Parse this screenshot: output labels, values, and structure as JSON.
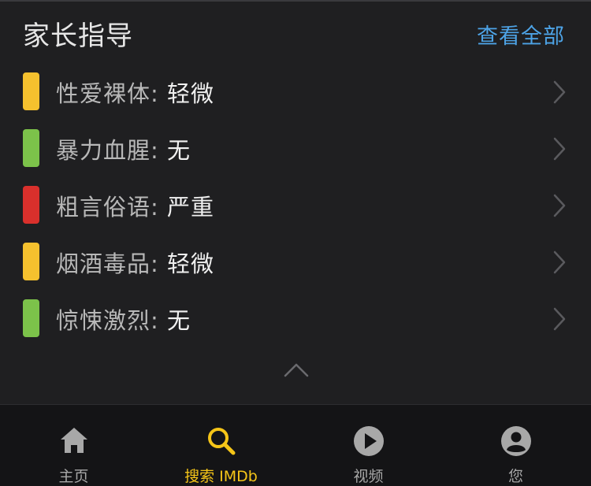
{
  "header": {
    "title": "家长指导",
    "see_all": "查看全部"
  },
  "guide": {
    "items": [
      {
        "category": "性爱裸体",
        "separator": ":",
        "level": "轻微",
        "color": "#f5c12e",
        "icon": "chevron-right"
      },
      {
        "category": "暴力血腥",
        "separator": ":",
        "level": "无",
        "color": "#7cc24a",
        "icon": "chevron-right"
      },
      {
        "category": "粗言俗语",
        "separator": ":",
        "level": "严重",
        "color": "#d9302c",
        "icon": "chevron-right"
      },
      {
        "category": "烟酒毒品",
        "separator": ":",
        "level": "轻微",
        "color": "#f5c12e",
        "icon": "chevron-right"
      },
      {
        "category": "惊悚激烈",
        "separator": ":",
        "level": "无",
        "color": "#7cc24a",
        "icon": "chevron-right"
      }
    ],
    "collapse_icon": "chevron-up"
  },
  "tabbar": {
    "active_color": "#f5c518",
    "inactive_color": "#a8a8a8",
    "tabs": [
      {
        "label": "主页",
        "icon": "home-icon",
        "active": false
      },
      {
        "label": "搜索 IMDb",
        "icon": "search-icon",
        "active": true
      },
      {
        "label": "视频",
        "icon": "play-icon",
        "active": false
      },
      {
        "label": "您",
        "icon": "profile-icon",
        "active": false
      }
    ]
  }
}
